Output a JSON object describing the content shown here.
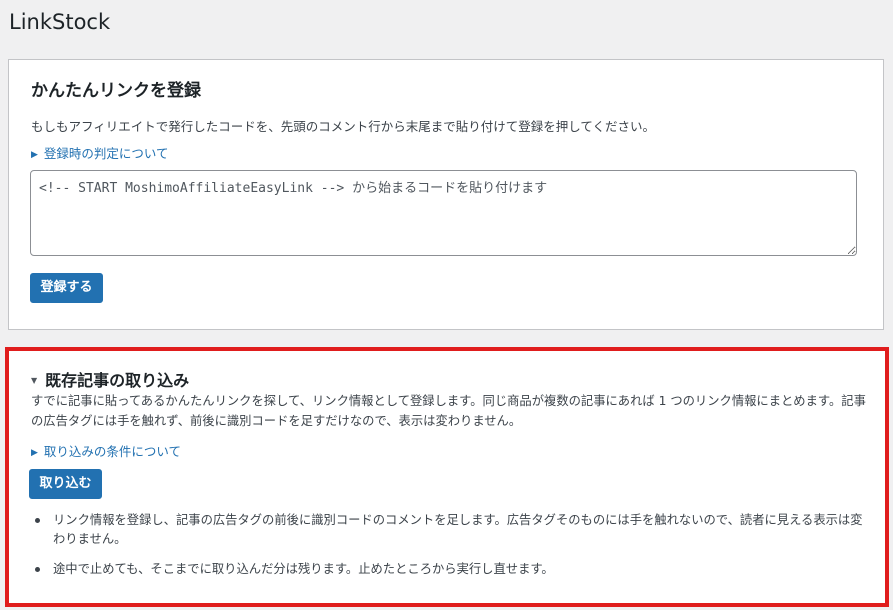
{
  "app": {
    "title": "LinkStock"
  },
  "easy_link": {
    "heading": "かんたんリンクを登録",
    "description": "もしもアフィリエイトで発行したコードを、先頭のコメント行から末尾まで貼り付けて登録を押してください。",
    "judgement_toggle": "登録時の判定について",
    "code_placeholder": "<!-- START MoshimoAffiliateEasyLink --> から始まるコードを貼り付けます",
    "code_value": "",
    "register_button": "登録する"
  },
  "import_existing": {
    "heading": "既存記事の取り込み",
    "description": "すでに記事に貼ってあるかんたんリンクを探して、リンク情報として登録します。同じ商品が複数の記事にあれば 1 つのリンク情報にまとめます。記事の広告タグには手を触れず、前後に識別コードを足すだけなので、表示は変わりません。",
    "conditions_toggle": "取り込みの条件について",
    "import_button": "取り込む",
    "notes": [
      "リンク情報を登録し、記事の広告タグの前後に識別コードのコメントを足します。広告タグそのものには手を触れないので、読者に見える表示は変わりません。",
      "途中で止めても、そこまでに取り込んだ分は残ります。止めたところから実行し直せます。"
    ]
  },
  "colors": {
    "accent": "#2271b1",
    "highlight_border": "#e01d1d",
    "background": "#f0f0f1"
  }
}
